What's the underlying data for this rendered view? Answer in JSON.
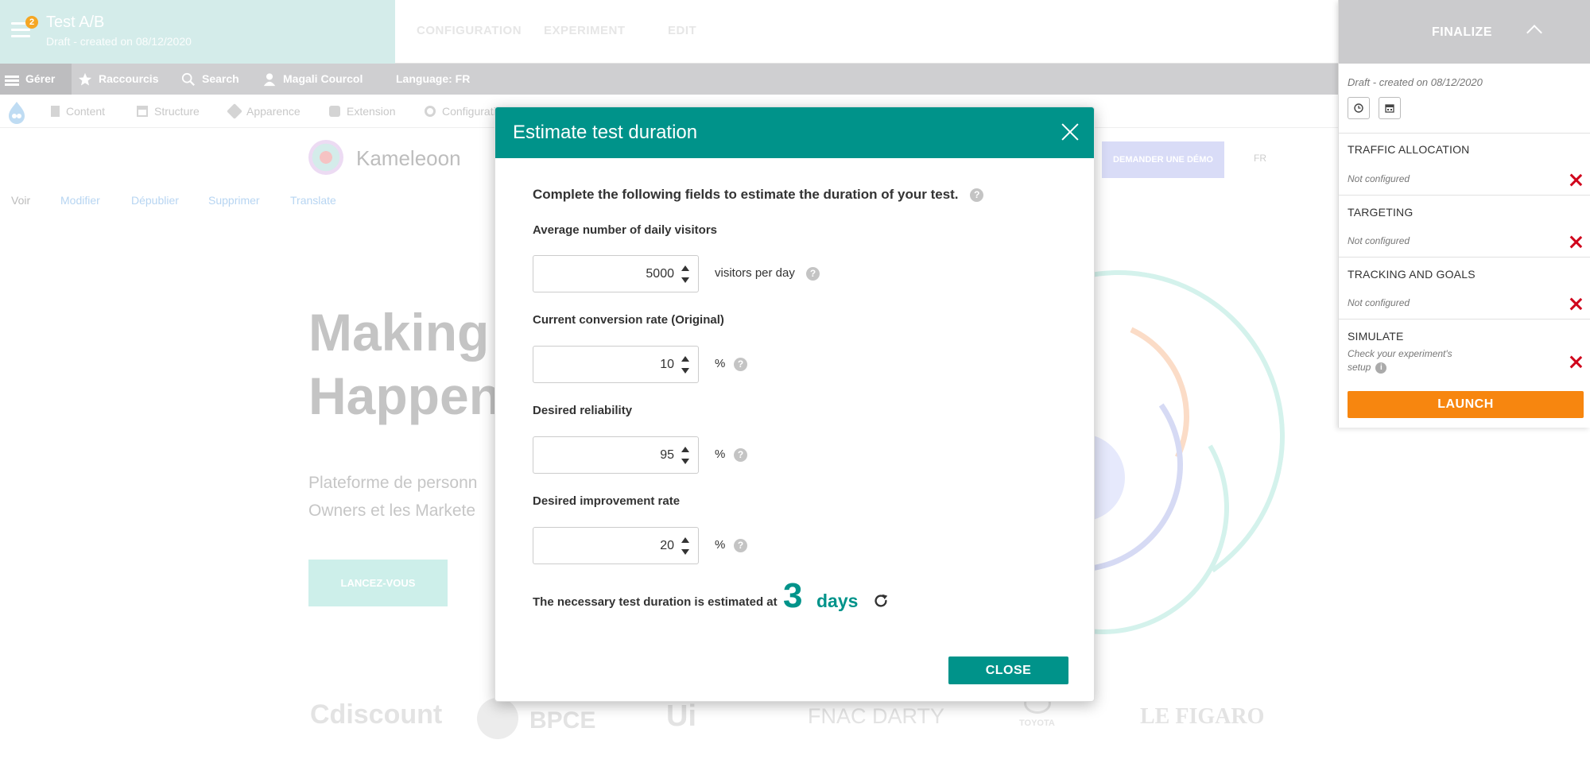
{
  "test": {
    "title": "Test A/B",
    "subtitle": "Draft - created on 08/12/2020",
    "notifications": "2"
  },
  "top_tabs": [
    "CONFIGURATION",
    "EXPERIMENT",
    "EDIT"
  ],
  "admin_bar": {
    "manage": "Gérer",
    "shortcuts": "Raccourcis",
    "search": "Search",
    "user": "Magali Courcol",
    "language": "Language: FR"
  },
  "tools_bar": [
    "Content",
    "Structure",
    "Apparence",
    "Extension",
    "Configuration"
  ],
  "site": {
    "brand": "Kameleoon",
    "demo_button": "DEMANDER UNE DÉMO",
    "lang": "FR",
    "links": [
      "Voir",
      "Modifier",
      "Dépublier",
      "Supprimer",
      "Translate"
    ],
    "hero_line1": "Making",
    "hero_line2": "Happen",
    "hero_text1": "Plateforme de personn",
    "hero_text2": "Owners et les Markete",
    "cta": "LANCEZ-VOUS",
    "clients": [
      "Cdiscount",
      "BPCE",
      "Ui",
      "FNAC DARTY",
      "TOYOTA",
      "LE FIGARO"
    ]
  },
  "panel": {
    "finalize": "FINALIZE",
    "draft_note": "Draft - created on 08/12/2020",
    "sections": [
      {
        "title": "TRAFFIC ALLOCATION",
        "status": "Not configured"
      },
      {
        "title": "TARGETING",
        "status": "Not configured"
      },
      {
        "title": "TRACKING AND GOALS",
        "status": "Not configured"
      },
      {
        "title": "SIMULATE",
        "status_line1": "Check your experiment's",
        "status_line2": "setup"
      }
    ],
    "launch": "LAUNCH"
  },
  "modal": {
    "title": "Estimate test duration",
    "intro": "Complete the following fields to estimate the duration of your test.",
    "fields": [
      {
        "label": "Average number of daily visitors",
        "value": "5000",
        "unit": "visitors per day"
      },
      {
        "label": "Current conversion rate (Original)",
        "value": "10",
        "unit": "%"
      },
      {
        "label": "Desired reliability",
        "value": "95",
        "unit": "%"
      },
      {
        "label": "Desired improvement rate",
        "value": "20",
        "unit": "%"
      }
    ],
    "result_label": "The necessary test duration is estimated at",
    "result_value": "3",
    "result_unit": "days",
    "close": "CLOSE"
  },
  "colors": {
    "accent": "#00938a",
    "launch": "#f7860f",
    "error": "#d0021b"
  }
}
